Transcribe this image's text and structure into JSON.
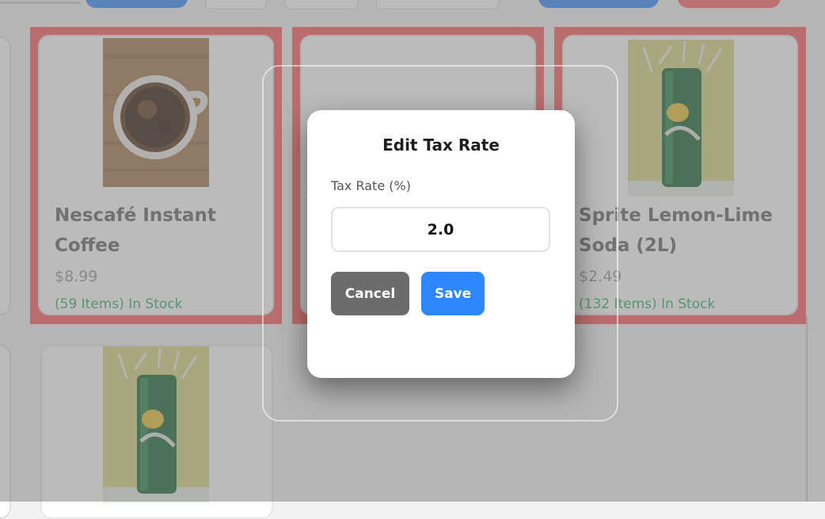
{
  "toolbar": {
    "accent": "#3d8cff",
    "danger": "#ff6b6b"
  },
  "products": [
    {
      "name_line1": "Nescafé Instant",
      "name_line2": "Coffee",
      "price": "$8.99",
      "stock": "(59 Items) In Stock",
      "image": "coffee-cup-image",
      "selected": true
    },
    {
      "name_line1": "",
      "name_line2": "",
      "price": "",
      "stock": "",
      "image": "",
      "selected": true
    },
    {
      "name_line1": "Sprite Lemon-Lime",
      "name_line2": "Soda (2L)",
      "price": "$2.49",
      "stock": "(132 Items) In Stock",
      "image": "sprite-can-image",
      "selected": true
    },
    {
      "name_line1": "",
      "name_line2": "",
      "price": "",
      "stock": "",
      "image": "sprite-can-image",
      "selected": false
    }
  ],
  "modal": {
    "title": "Edit Tax Rate",
    "field_label": "Tax Rate (%)",
    "tax_rate_value": "2.0",
    "cancel_label": "Cancel",
    "save_label": "Save"
  },
  "colors": {
    "selection_highlight": "#ff6262",
    "stock_green": "#3bb16a",
    "save_button": "#2f87ff",
    "cancel_button": "#6c6c6c"
  }
}
